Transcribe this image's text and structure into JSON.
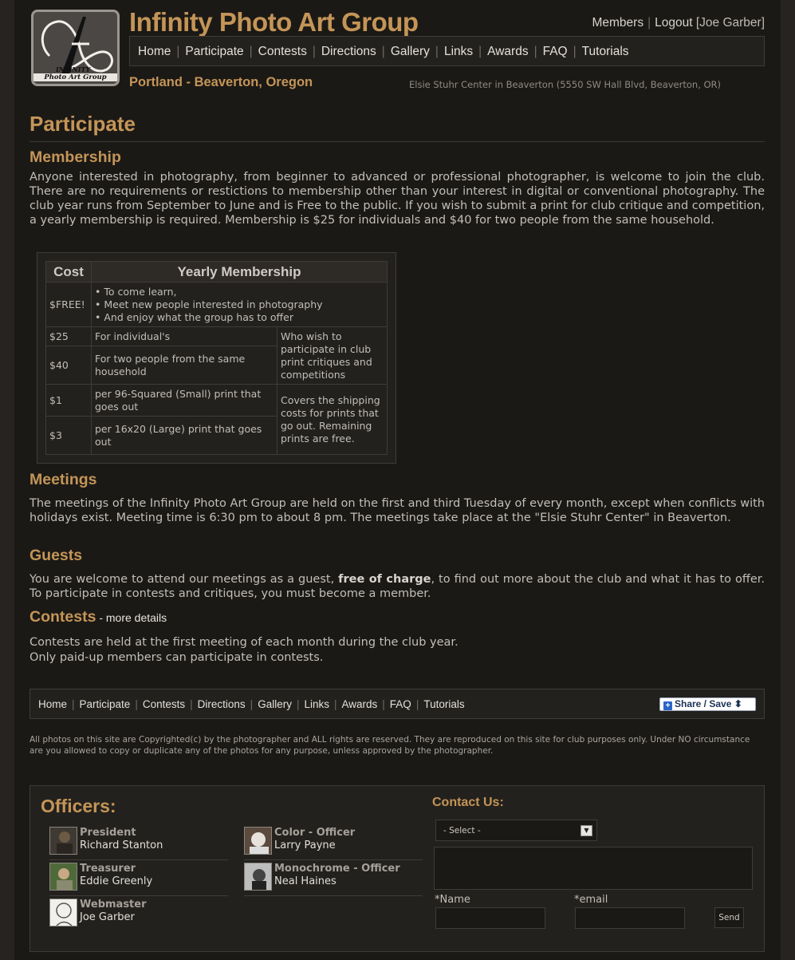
{
  "header": {
    "site_title": "Infinity Photo Art Group",
    "logo_text": "INFINITY",
    "logo_subtext": "Photo Art Group",
    "location": "Portland - Beaverton, Oregon",
    "address": "Elsie Stuhr Center in Beaverton (5550 SW Hall Blvd, Beaverton, OR)",
    "members_link": "Members",
    "logout_link": "Logout",
    "user": "[Joe Garber]"
  },
  "nav": [
    "Home",
    "Participate",
    "Contests",
    "Directions",
    "Gallery",
    "Links",
    "Awards",
    "FAQ",
    "Tutorials"
  ],
  "page_title": "Participate",
  "membership": {
    "heading": "Membership",
    "text": "Anyone interested in photography, from beginner to advanced or professional photographer, is welcome to join the club. There are no requirements or restictions to membership other than your interest in digital or conventional photography. The club year runs from September to June and is Free to the public. If you wish to submit a print for club critique and competition, a yearly membership is required. Membership is $25 for individuals and $40 for two people from the same household."
  },
  "table": {
    "col_cost": "Cost",
    "col_membership": "Yearly Membership",
    "free_cost": "$FREE!",
    "free_items": [
      "To come learn,",
      "Meet new people interested in photography",
      "And enjoy what the group has to offer"
    ],
    "row25_cost": "$25",
    "row25_desc": "For individual's",
    "row40_cost": "$40",
    "row40_desc": "For two people from the same household",
    "members_note": "Who wish to participate in club print critiques and competitions",
    "row1_cost": "$1",
    "row1_desc": "per 96-Squared (Small) print that goes out",
    "row3_cost": "$3",
    "row3_desc": "per 16x20 (Large) print that goes out",
    "shipping_note": "Covers the shipping costs for prints that go out. Remaining prints are free."
  },
  "meetings": {
    "heading": "Meetings",
    "text": "The meetings of the Infinity Photo Art Group are held on the first and third Tuesday of every month, except when conflicts with holidays exist. Meeting time is 6:30 pm to about 8 pm. The meetings take place at the \"Elsie Stuhr Center\" in Beaverton."
  },
  "guests": {
    "heading": "Guests",
    "text_before": "You are welcome to attend our meetings as a guest, ",
    "text_bold": "free of charge",
    "text_after": ", to find out more about the club and what it has to offer. To participate in contests and critiques, you must become a member."
  },
  "contests": {
    "heading": "Contests",
    "more_link": " - more details",
    "line1": "Contests are held at the first meeting of each month during the club year.",
    "line2": "Only paid-up members can participate in contests."
  },
  "footer": {
    "share_label": "Share / Save",
    "share_arrows": "⬍",
    "copyright": "All photos on this site are Copyrighted(c) by the photographer and ALL rights are reserved. They are reproduced on this site for club purposes only. Under NO circumstance are you allowed to copy or duplicate any of the photos for any purpose, unless approved by the photographer."
  },
  "officers": {
    "title": "Officers:",
    "list": [
      {
        "role": "President",
        "name": "Richard Stanton"
      },
      {
        "role": "Treasurer",
        "name": "Eddie Greenly"
      },
      {
        "role": "Webmaster",
        "name": "Joe Garber"
      },
      {
        "role": "Color - Officer",
        "name": "Larry Payne"
      },
      {
        "role": "Monochrome - Officer",
        "name": "Neal Haines"
      }
    ]
  },
  "contact": {
    "title": "Contact Us:",
    "select_value": "- Select -",
    "name_label": "*Name",
    "email_label": "*email",
    "send_label": "Send"
  }
}
